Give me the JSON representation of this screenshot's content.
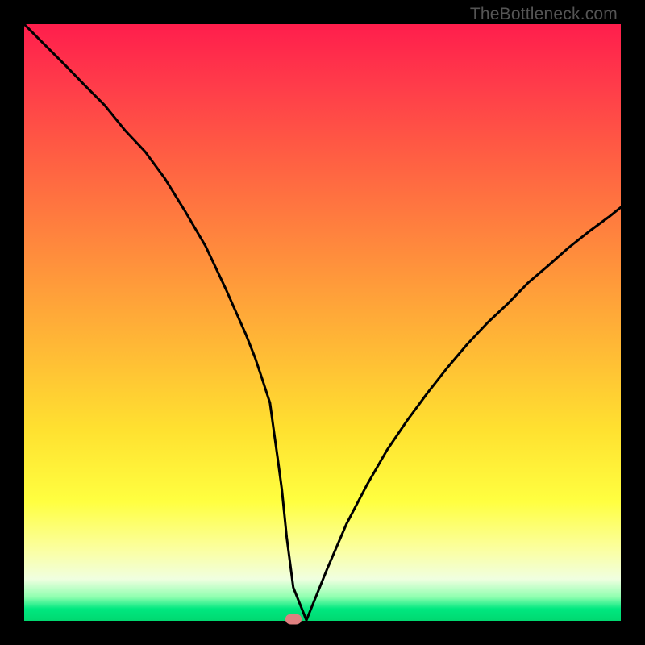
{
  "watermark": "TheBottleneck.com",
  "chart_data": {
    "type": "line",
    "title": "",
    "xlabel": "",
    "ylabel": "",
    "xlim": [
      0,
      100
    ],
    "ylim": [
      0,
      100
    ],
    "series": [
      {
        "name": "curve",
        "x": [
          0,
          3.4,
          6.8,
          10.1,
          13.5,
          16.9,
          20.3,
          23.6,
          27.0,
          28.4,
          30.4,
          33.8,
          37.2,
          38.7,
          39.9,
          41.2,
          41.9,
          42.6,
          43.2,
          44.0,
          45.1,
          47.3,
          50.7,
          54.0,
          57.4,
          60.8,
          64.2,
          67.6,
          70.9,
          74.3,
          77.7,
          81.1,
          84.4,
          87.8,
          91.2,
          94.6,
          98.0,
          100.0
        ],
        "values": [
          100.0,
          96.6,
          93.2,
          89.8,
          86.4,
          82.2,
          78.6,
          74.1,
          68.6,
          66.2,
          62.8,
          55.6,
          47.9,
          44.1,
          40.5,
          36.5,
          31.4,
          26.4,
          21.9,
          14.0,
          5.6,
          0.1,
          8.5,
          16.2,
          22.7,
          28.6,
          33.6,
          38.2,
          42.4,
          46.4,
          50.0,
          53.2,
          56.6,
          59.5,
          62.5,
          65.2,
          67.7,
          69.3
        ]
      }
    ],
    "marker": {
      "x": 45.1,
      "y": 0.3
    }
  }
}
